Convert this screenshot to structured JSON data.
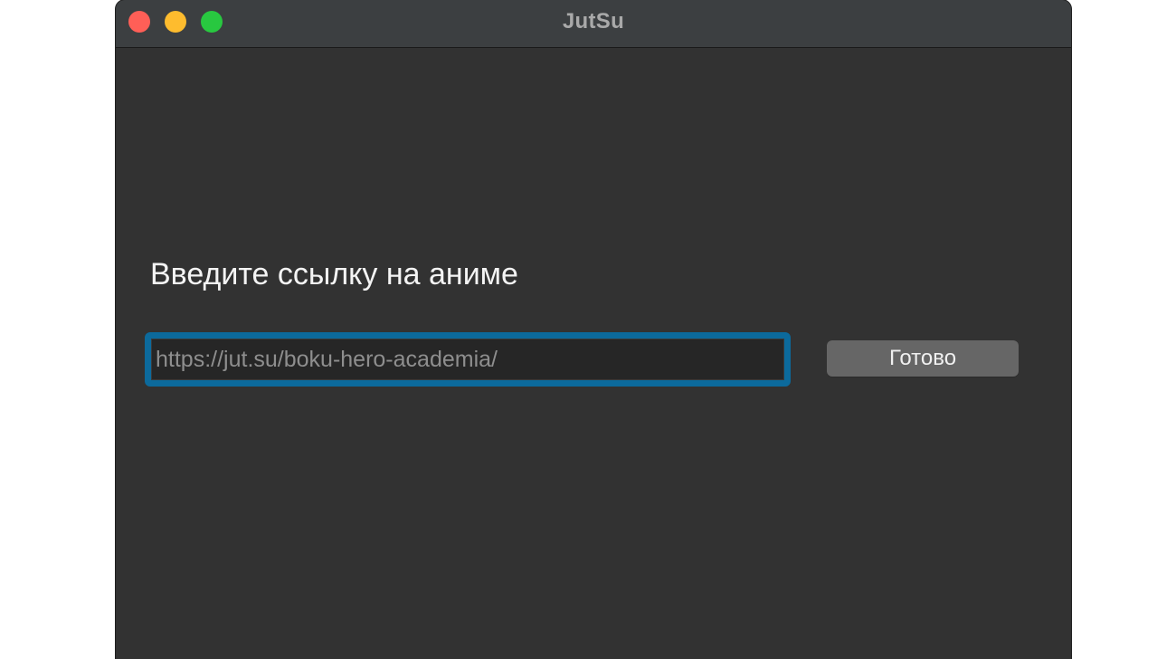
{
  "window": {
    "title": "JutSu",
    "controls": [
      {
        "name": "close",
        "color": "#ff5f57"
      },
      {
        "name": "minimize",
        "color": "#febc2e"
      },
      {
        "name": "zoom",
        "color": "#28c840"
      }
    ]
  },
  "main": {
    "prompt": "Введите ссылку на аниме",
    "url_input": {
      "value": "",
      "placeholder": "https://jut.su/boku-hero-academia/"
    },
    "submit_label": "Готово"
  },
  "colors": {
    "window_bg": "#323232",
    "titlebar_bg": "#3c3f41",
    "focus_ring": "#0c6a9c",
    "button_bg": "#666666"
  }
}
